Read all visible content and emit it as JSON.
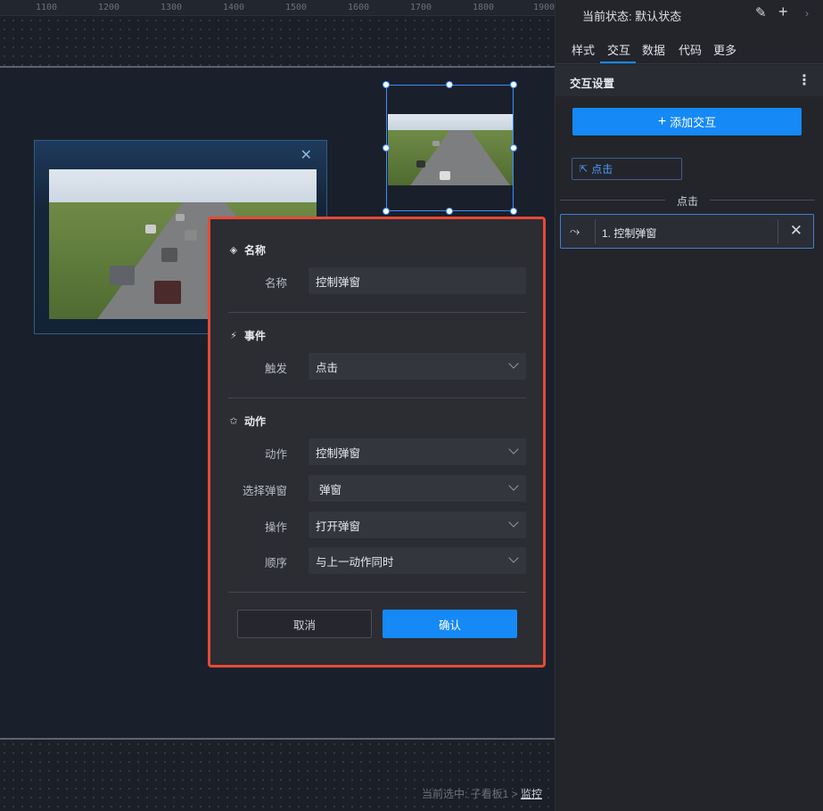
{
  "ruler": {
    "ticks": [
      "1100",
      "1200",
      "1300",
      "1400",
      "1500",
      "1600",
      "1700",
      "1800",
      "1900"
    ]
  },
  "breadcrumb": {
    "prefix": "当前选中: 子看板1 >",
    "current": "监控"
  },
  "dialog": {
    "section_name": {
      "title": "名称",
      "icon": "diamond-icon"
    },
    "name_label": "名称",
    "name_value": "控制弹窗",
    "section_event": {
      "title": "事件",
      "icon": "lightning-icon"
    },
    "trigger_label": "触发",
    "trigger_value": "点击",
    "section_action": {
      "title": "动作",
      "icon": "star-icon"
    },
    "action_label": "动作",
    "action_value": "控制弹窗",
    "select_popup_label": "选择弹窗",
    "select_popup_value": "弹窗",
    "operation_label": "操作",
    "operation_value": "打开弹窗",
    "order_label": "顺序",
    "order_value": "与上一动作同时",
    "cancel_label": "取消",
    "confirm_label": "确认"
  },
  "panel": {
    "state_text": "当前状态:  默认状态",
    "tabs": [
      "样式",
      "交互",
      "数据",
      "代码",
      "更多"
    ],
    "active_tab": "交互",
    "section_title": "交互设置",
    "add_button": "添加交互",
    "event_tag": "点击",
    "separator_label": "点击",
    "action_item": "1. 控制弹窗"
  },
  "colors": {
    "accent": "#1589f5",
    "dialog_border": "#e64a35",
    "arrow": "#e64a35"
  }
}
